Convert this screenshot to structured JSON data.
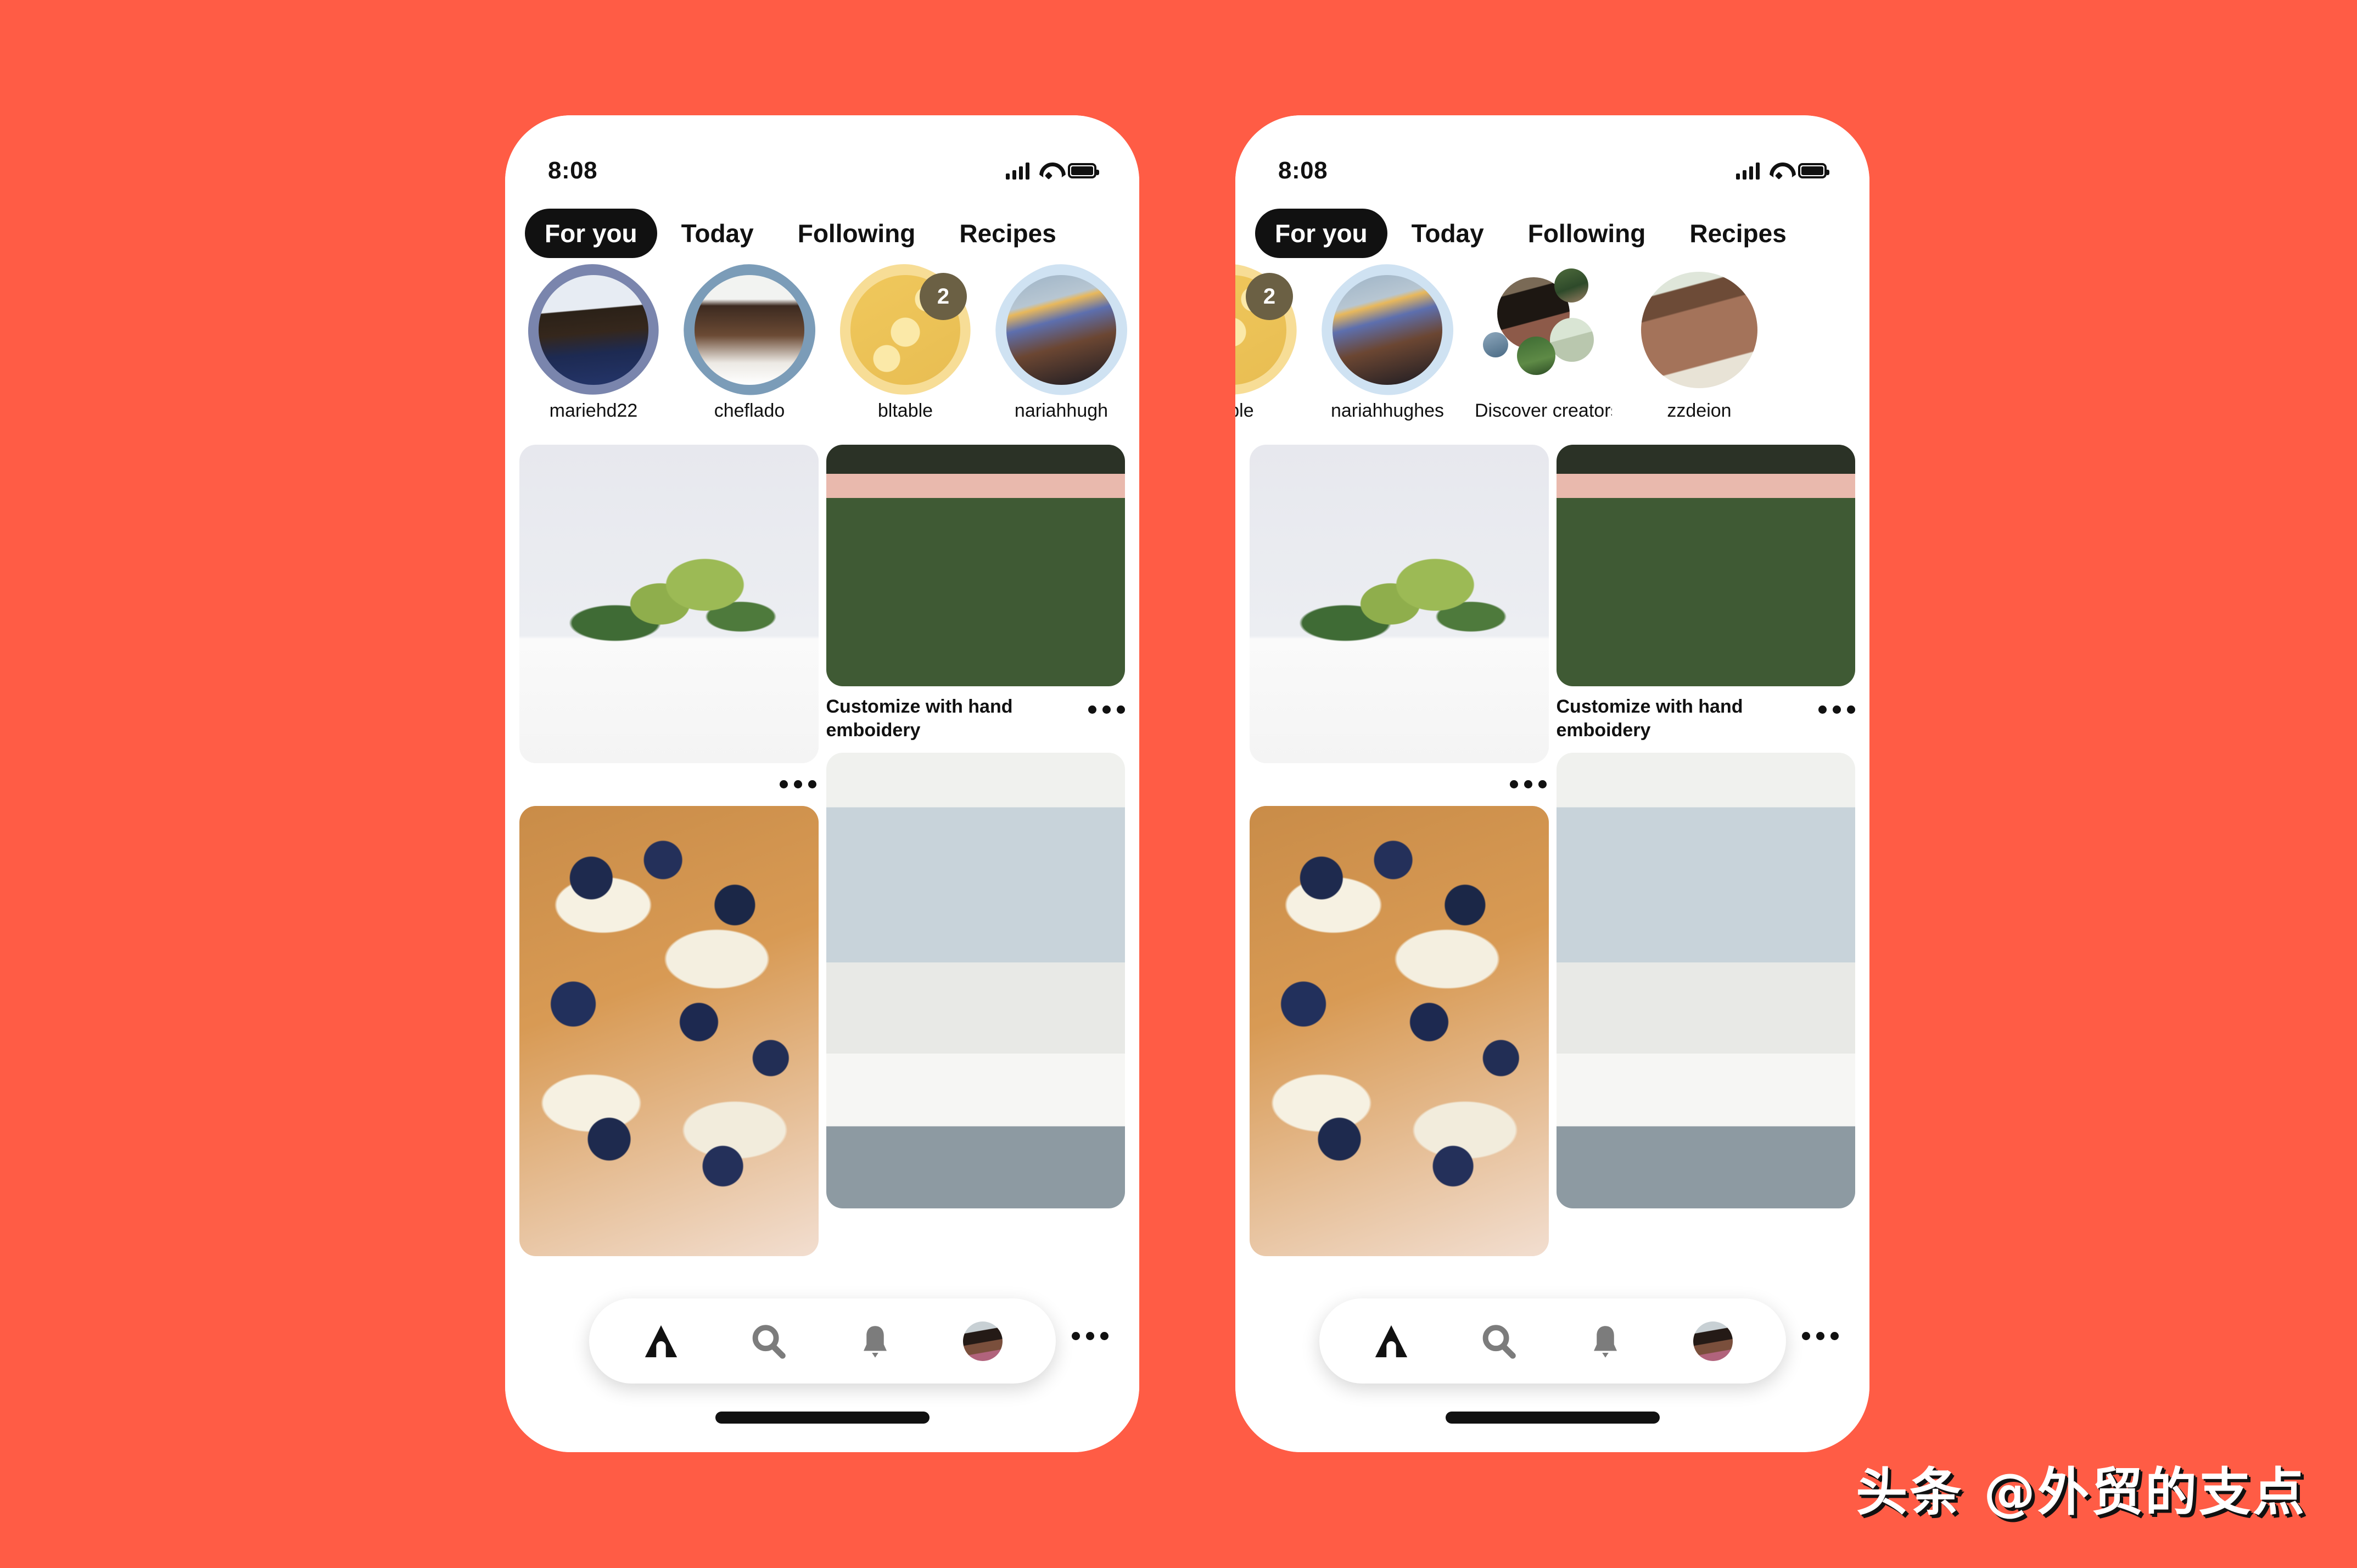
{
  "background_color": "#FF5C45",
  "watermark": {
    "text": "头条 @外贸的支点"
  },
  "phones": [
    {
      "id": "phone-left",
      "status": {
        "time": "8:08",
        "signal_icon": "cellular-signal-icon",
        "wifi_icon": "wifi-icon",
        "battery_icon": "battery-icon"
      },
      "tabs": [
        {
          "label": "For you",
          "active": true
        },
        {
          "label": "Today",
          "active": false
        },
        {
          "label": "Following",
          "active": false
        },
        {
          "label": "Recipes",
          "active": false
        }
      ],
      "stories": [
        {
          "name": "mariehd22",
          "badge": "",
          "ring_color": "#7a85ad",
          "avatar_desc": "woman-with-top-knot"
        },
        {
          "name": "cheflado",
          "badge": "",
          "ring_color": "#7b9cb8",
          "avatar_desc": "smiling-chef"
        },
        {
          "name": "bltable",
          "badge": "2",
          "ring_color": "#f5cf72",
          "avatar_desc": "lemon-slices-yellow"
        },
        {
          "name": "nariahhugh",
          "badge": "",
          "ring_color": "#cfe2f2",
          "avatar_desc": "woman-with-headwrap"
        }
      ],
      "feed": {
        "left_column": [
          {
            "name": "green-floral-arrangement-pin",
            "caption": "",
            "overflow_icon": "more-options-icon"
          },
          {
            "name": "blueberry-ricotta-toast-pin",
            "caption": "",
            "overflow_icon": ""
          }
        ],
        "right_column": [
          {
            "name": "embroidered-jacket-pin",
            "caption": "Customize with hand emboidery",
            "overflow_icon": "more-options-icon"
          },
          {
            "name": "boho-bathroom-pin",
            "caption": "",
            "overflow_icon": ""
          }
        ]
      },
      "bottom_nav": [
        {
          "name": "home",
          "icon": "home-icon",
          "active": true
        },
        {
          "name": "search",
          "icon": "search-icon",
          "active": false
        },
        {
          "name": "notifications",
          "icon": "bell-icon",
          "active": false
        },
        {
          "name": "profile",
          "icon": "avatar-icon",
          "active": false
        }
      ],
      "overflow_icon": "more-options-icon"
    },
    {
      "id": "phone-right",
      "status": {
        "time": "8:08",
        "signal_icon": "cellular-signal-icon",
        "wifi_icon": "wifi-icon",
        "battery_icon": "battery-icon"
      },
      "tabs": [
        {
          "label": "For you",
          "active": true
        },
        {
          "label": "Today",
          "active": false
        },
        {
          "label": "Following",
          "active": false
        },
        {
          "label": "Recipes",
          "active": false
        }
      ],
      "stories": [
        {
          "name": "ltable",
          "badge": "2",
          "ring_color": "#f5cf72",
          "avatar_desc": "lemon-slices-yellow"
        },
        {
          "name": "nariahhughes",
          "badge": "",
          "ring_color": "#cfe2f2",
          "avatar_desc": "woman-with-headwrap"
        },
        {
          "name": "Discover creators",
          "badge": "",
          "ring_color": "#ffffff",
          "avatar_desc": "creator-cluster"
        },
        {
          "name": "zzdeion",
          "badge": "",
          "ring_color": "#ffffff",
          "avatar_desc": "smiling-man-glasses"
        }
      ],
      "feed": {
        "left_column": [
          {
            "name": "green-floral-arrangement-pin",
            "caption": "",
            "overflow_icon": "more-options-icon"
          },
          {
            "name": "blueberry-ricotta-toast-pin",
            "caption": "",
            "overflow_icon": ""
          }
        ],
        "right_column": [
          {
            "name": "embroidered-jacket-pin",
            "caption": "Customize with hand emboidery",
            "overflow_icon": "more-options-icon"
          },
          {
            "name": "boho-bathroom-pin",
            "caption": "",
            "overflow_icon": ""
          }
        ]
      },
      "bottom_nav": [
        {
          "name": "home",
          "icon": "home-icon",
          "active": true
        },
        {
          "name": "search",
          "icon": "search-icon",
          "active": false
        },
        {
          "name": "notifications",
          "icon": "bell-icon",
          "active": false
        },
        {
          "name": "profile",
          "icon": "avatar-icon",
          "active": false
        }
      ],
      "overflow_icon": "more-options-icon"
    }
  ]
}
